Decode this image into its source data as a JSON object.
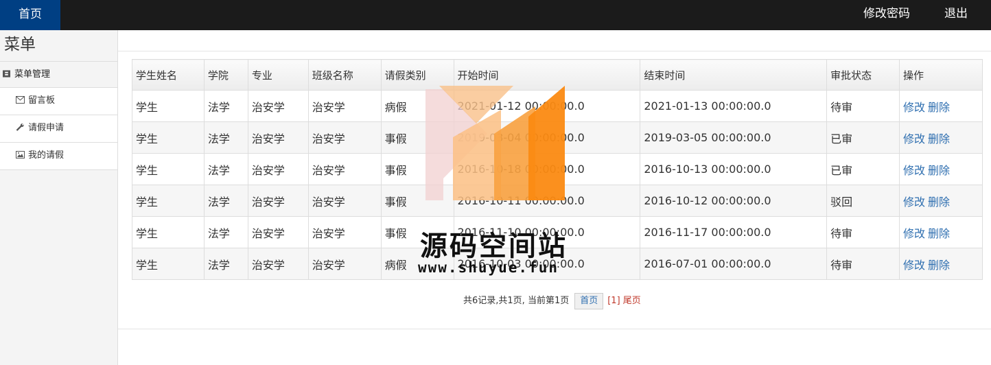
{
  "topbar": {
    "home": "首页",
    "change_password": "修改密码",
    "logout": "退出"
  },
  "sidebar": {
    "title": "菜单",
    "group": "菜单管理",
    "items": [
      {
        "label": "留言板",
        "icon": "envelope-icon"
      },
      {
        "label": "请假申请",
        "icon": "wrench-icon"
      },
      {
        "label": "我的请假",
        "icon": "picture-icon"
      }
    ]
  },
  "table": {
    "headers": [
      "学生姓名",
      "学院",
      "专业",
      "班级名称",
      "请假类别",
      "开始时间",
      "结束时间",
      "审批状态",
      "操作"
    ],
    "rows": [
      [
        "学生",
        "法学",
        "治安学",
        "治安学",
        "病假",
        "2021-01-12 00:00:00.0",
        "2021-01-13 00:00:00.0",
        "待审"
      ],
      [
        "学生",
        "法学",
        "治安学",
        "治安学",
        "事假",
        "2019-03-04 00:00:00.0",
        "2019-03-05 00:00:00.0",
        "已审"
      ],
      [
        "学生",
        "法学",
        "治安学",
        "治安学",
        "事假",
        "2016-10-18 00:00:00.0",
        "2016-10-13 00:00:00.0",
        "已审"
      ],
      [
        "学生",
        "法学",
        "治安学",
        "治安学",
        "事假",
        "2016-10-11 00:00:00.0",
        "2016-10-12 00:00:00.0",
        "驳回"
      ],
      [
        "学生",
        "法学",
        "治安学",
        "治安学",
        "事假",
        "2016-11-10 00:00:00.0",
        "2016-11-17 00:00:00.0",
        "待审"
      ],
      [
        "学生",
        "法学",
        "治安学",
        "治安学",
        "病假",
        "2016-10-03 00:00:00.0",
        "2016-07-01 00:00:00.0",
        "待审"
      ]
    ],
    "actions": {
      "edit": "修改",
      "delete": "删除"
    }
  },
  "pager": {
    "summary": "共6记录,共1页, 当前第1页",
    "first": "首页",
    "current": "[1]",
    "last": "尾页"
  },
  "watermark": {
    "title": "源码空间站",
    "url": "www.shuyue.fun"
  },
  "colors": {
    "topbar": "#1b1b1b",
    "home_tab": "#003f83",
    "link": "#2f6fb0",
    "pager_current": "#c0392b"
  }
}
